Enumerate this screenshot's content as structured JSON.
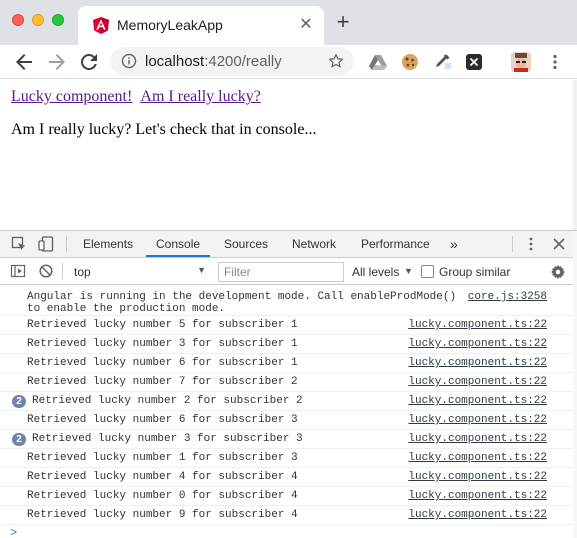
{
  "browser": {
    "tab_title": "MemoryLeakApp",
    "url_host": "localhost",
    "url_rest": ":4200/really",
    "icons": [
      "angular-favicon",
      "close-icon",
      "plus-icon",
      "back-arrow-icon",
      "forward-arrow-icon",
      "reload-icon",
      "info-icon",
      "star-icon",
      "drive-icon",
      "cookie-icon",
      "eyedropper-icon",
      "x-extension-icon",
      "avatar",
      "kebab-menu-icon"
    ]
  },
  "page": {
    "link1": "Lucky component!",
    "link2": "Am I really lucky?",
    "text": "Am I really lucky? Let's check that in console..."
  },
  "devtools": {
    "tabs": [
      "Elements",
      "Console",
      "Sources",
      "Network",
      "Performance"
    ],
    "more": "»",
    "active_tab": "Console",
    "context": "top",
    "filter_placeholder": "Filter",
    "levels": "All levels",
    "group_similar": "Group similar",
    "accent_color": "#1a73e8"
  },
  "console": {
    "messages": [
      {
        "text": "Angular is running in the development mode. Call enableProdMode()\nto enable the production mode.",
        "source": "core.js:3258",
        "count": ""
      },
      {
        "text": "Retrieved lucky number 5 for subscriber 1",
        "source": "lucky.component.ts:22",
        "count": ""
      },
      {
        "text": "Retrieved lucky number 3 for subscriber 1",
        "source": "lucky.component.ts:22",
        "count": ""
      },
      {
        "text": "Retrieved lucky number 6 for subscriber 1",
        "source": "lucky.component.ts:22",
        "count": ""
      },
      {
        "text": "Retrieved lucky number 7 for subscriber 2",
        "source": "lucky.component.ts:22",
        "count": ""
      },
      {
        "text": "Retrieved lucky number 2 for subscriber 2",
        "source": "lucky.component.ts:22",
        "count": "2"
      },
      {
        "text": "Retrieved lucky number 6 for subscriber 3",
        "source": "lucky.component.ts:22",
        "count": ""
      },
      {
        "text": "Retrieved lucky number 3 for subscriber 3",
        "source": "lucky.component.ts:22",
        "count": "2"
      },
      {
        "text": "Retrieved lucky number 1 for subscriber 3",
        "source": "lucky.component.ts:22",
        "count": ""
      },
      {
        "text": "Retrieved lucky number 4 for subscriber 4",
        "source": "lucky.component.ts:22",
        "count": ""
      },
      {
        "text": "Retrieved lucky number 0 for subscriber 4",
        "source": "lucky.component.ts:22",
        "count": ""
      },
      {
        "text": "Retrieved lucky number 9 for subscriber 4",
        "source": "lucky.component.ts:22",
        "count": ""
      }
    ],
    "prompt": ">"
  }
}
